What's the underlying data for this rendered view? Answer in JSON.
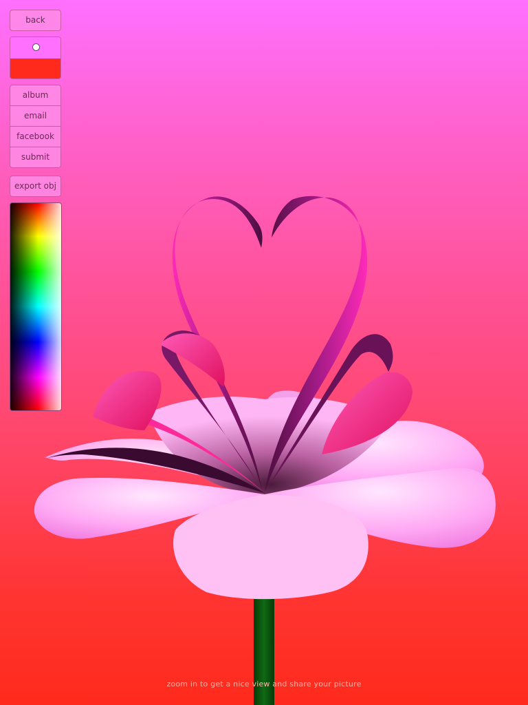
{
  "toolbar": {
    "back_label": "back",
    "share_buttons": [
      "album",
      "email",
      "facebook",
      "submit"
    ],
    "export_label": "export obj"
  },
  "colors": {
    "background_top": "#ff70ff",
    "background_bottom": "#ff2a1c",
    "swatch_primary": "#ff70ff",
    "swatch_secondary": "#ff2a1c",
    "petal_pink": "#ff9af0",
    "ribbon_magenta": "#ff1aa8",
    "ribbon_dark": "#5a1048",
    "stem_green": "#0b5a10"
  },
  "canvas": {
    "hint_text": "zoom in to get a nice view and share your picture"
  }
}
